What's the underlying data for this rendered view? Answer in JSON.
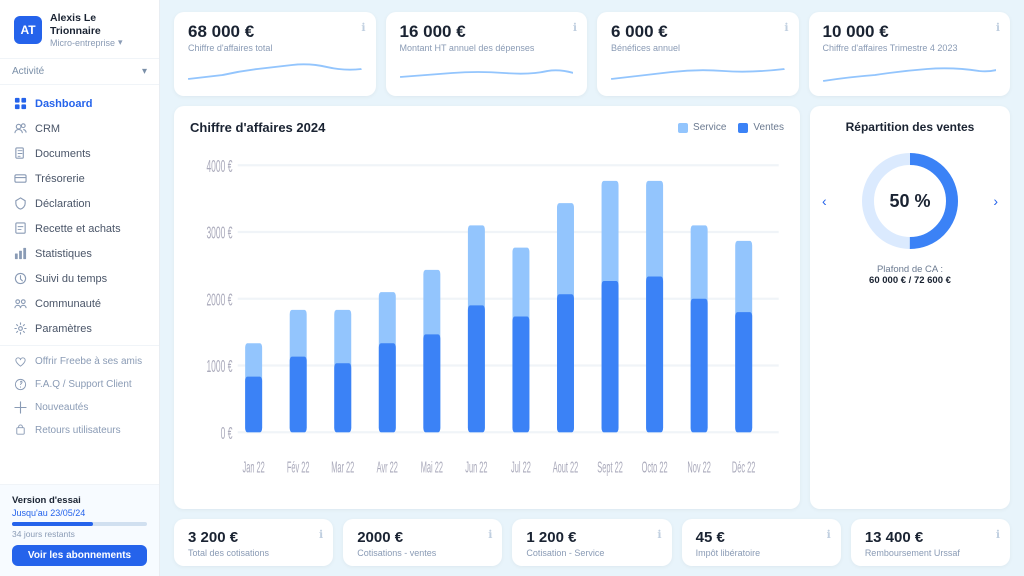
{
  "app": {
    "name": "Alexis Le Trionnaire",
    "type": "Micro-entreprise",
    "logo_letters": "AT"
  },
  "sidebar": {
    "activity_label": "Activité",
    "nav_items": [
      {
        "id": "dashboard",
        "label": "Dashboard",
        "icon": "grid"
      },
      {
        "id": "crm",
        "label": "CRM",
        "icon": "users"
      },
      {
        "id": "documents",
        "label": "Documents",
        "icon": "file"
      },
      {
        "id": "tresorerie",
        "label": "Trésorerie",
        "icon": "wallet"
      },
      {
        "id": "declaration",
        "label": "Déclaration",
        "icon": "flag"
      },
      {
        "id": "recette",
        "label": "Recette et achats",
        "icon": "receipt"
      },
      {
        "id": "statistiques",
        "label": "Statistiques",
        "icon": "chart"
      },
      {
        "id": "suivi",
        "label": "Suivi du temps",
        "icon": "clock"
      },
      {
        "id": "communaute",
        "label": "Communauté",
        "icon": "community"
      },
      {
        "id": "parametres",
        "label": "Paramètres",
        "icon": "gear"
      }
    ],
    "bottom_items": [
      {
        "label": "Offrir Freebe à ses amis",
        "icon": "heart"
      },
      {
        "label": "F.A.Q / Support Client",
        "icon": "question"
      },
      {
        "label": "Nouveautés",
        "icon": "plus"
      },
      {
        "label": "Retours utilisateurs",
        "icon": "lock"
      }
    ],
    "version": {
      "label": "Version d'essai",
      "date": "Jusqu'au 23/05/24",
      "days": "34 jours restants",
      "progress": 60,
      "btn_label": "Voir les abonnements"
    }
  },
  "kpi": [
    {
      "value": "68 000 €",
      "label": "Chiffre d'affaires total"
    },
    {
      "value": "16 000 €",
      "label": "Montant HT annuel des dépenses"
    },
    {
      "value": "6 000 €",
      "label": "Bénéfices annuel"
    },
    {
      "value": "10 000 €",
      "label": "Chiffre d'affaires Trimestre 4 2023"
    }
  ],
  "chart": {
    "title": "Chiffre d'affaires 2024",
    "legend": [
      {
        "label": "Service",
        "color": "#93c5fd"
      },
      {
        "label": "Ventes",
        "color": "#3b82f6"
      }
    ],
    "y_labels": [
      "4000 €",
      "3000 €",
      "2000 €",
      "1000 €",
      "0 €"
    ],
    "x_labels": [
      "Jan 22",
      "Fév 22",
      "Mar 22",
      "Avr 22",
      "Mai 22",
      "Jun 22",
      "Jul 22",
      "Aout 22",
      "Sept 22",
      "Octo 22",
      "Nov 22",
      "Déc 22"
    ],
    "bars": [
      {
        "service": 40,
        "ventes": 25
      },
      {
        "service": 55,
        "ventes": 35
      },
      {
        "service": 55,
        "ventes": 30
      },
      {
        "service": 65,
        "ventes": 38
      },
      {
        "service": 75,
        "ventes": 42
      },
      {
        "service": 95,
        "ventes": 55
      },
      {
        "service": 85,
        "ventes": 50
      },
      {
        "service": 100,
        "ventes": 60
      },
      {
        "service": 115,
        "ventes": 65
      },
      {
        "service": 115,
        "ventes": 68
      },
      {
        "service": 95,
        "ventes": 58
      },
      {
        "service": 88,
        "ventes": 52
      }
    ]
  },
  "donut": {
    "title": "Répartition des ventes",
    "value": "50 %",
    "service_pct": 50,
    "ventes_pct": 50,
    "caption_label": "Plafond de CA :",
    "caption_value": "60 000 € / 72 600 €",
    "color_service": "#dbeafe",
    "color_ventes": "#3b82f6"
  },
  "bottom_kpi": [
    {
      "value": "3 200 €",
      "label": "Total des cotisations"
    },
    {
      "value": "2000 €",
      "label": "Cotisations - ventes"
    },
    {
      "value": "1 200 €",
      "label": "Cotisation - Service"
    },
    {
      "value": "45 €",
      "label": "Impôt libératoire"
    },
    {
      "value": "13 400 €",
      "label": "Remboursement Urssaf"
    }
  ]
}
